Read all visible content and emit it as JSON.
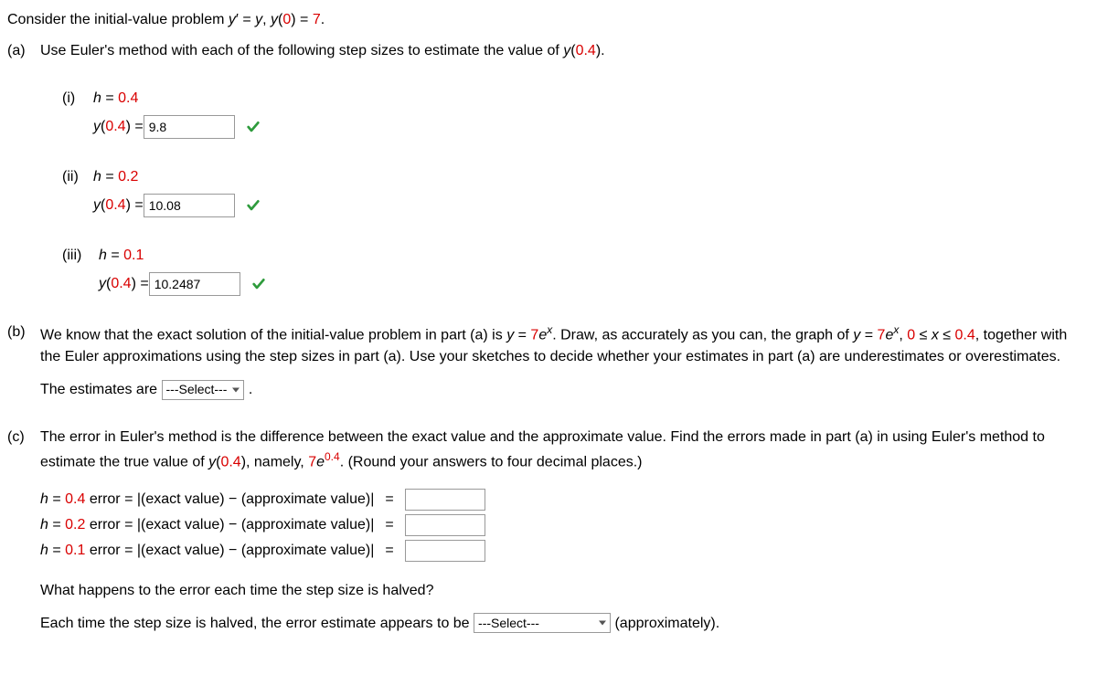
{
  "intro": {
    "prefix": "Consider the initial-value problem ",
    "eq_y": "y",
    "eq_prime": "′",
    "eq_mid1": " = ",
    "eq_rhs": "y",
    "eq_comma": ", ",
    "cond_y": "y",
    "cond_open": "(",
    "cond_val": "0",
    "cond_close": ") = ",
    "cond_rhs": "7",
    "period": "."
  },
  "partA": {
    "label": "(a)",
    "text_pre": "Use Euler's method with each of the following step sizes to estimate the value of ",
    "y": "y",
    "open": "(",
    "arg": "0.4",
    "close": ")",
    "period": ".",
    "items": [
      {
        "label": "(i)",
        "h": "h",
        "eq": " = ",
        "hval": "0.4",
        "y": "y",
        "open": "(",
        "arg": "0.4",
        "close": ") = ",
        "value": "9.8"
      },
      {
        "label": "(ii)",
        "h": "h",
        "eq": " = ",
        "hval": "0.2",
        "y": "y",
        "open": "(",
        "arg": "0.4",
        "close": ") = ",
        "value": "10.08"
      },
      {
        "label": "(iii)",
        "h": "h",
        "eq": " = ",
        "hval": "0.1",
        "y": "y",
        "open": "(",
        "arg": "0.4",
        "close": ") = ",
        "value": "10.2487"
      }
    ]
  },
  "partB": {
    "label": "(b)",
    "t1": "We know that the exact solution of the initial-value problem in part (a) is ",
    "y1": "y",
    "eq1": " = ",
    "coef1": "7",
    "e1": "e",
    "x1": "x",
    "t2": ". Draw, as accurately as you can, the graph of ",
    "y2": "y",
    "eq2": " = ",
    "coef2": "7",
    "e2": "e",
    "x2": "x",
    "t3": ", ",
    "range1": "0",
    "leq1": " ≤ ",
    "xvar": "x",
    "leq2": " ≤ ",
    "range2": "0.4",
    "t4": ", together with the Euler approximations using the step sizes in part (a). Use your sketches to decide whether your estimates in part (a) are underestimates or overestimates.",
    "conclusion_pre": "The estimates are ",
    "select_placeholder": "---Select---",
    "conclusion_post": " ."
  },
  "partC": {
    "label": "(c)",
    "t1": "The error in Euler's method is the difference between the exact value and the approximate value. Find the errors made in part (a) in using Euler's method to estimate the true value of ",
    "y": "y",
    "open": "(",
    "arg": "0.4",
    "close": ")",
    "t2": ", namely, ",
    "coef": "7",
    "e": "e",
    "exp": "0.4",
    "t3": ". (Round your answers to four decimal places.)",
    "errors": [
      {
        "h": "h",
        "eq1": " = ",
        "hval": "0.4",
        "label": " error = |(exact value) − (approximate value)|",
        "eq2": "="
      },
      {
        "h": "h",
        "eq1": " = ",
        "hval": "0.2",
        "label": " error = |(exact value) − (approximate value)|",
        "eq2": "="
      },
      {
        "h": "h",
        "eq1": " = ",
        "hval": "0.1",
        "label": " error = |(exact value) − (approximate value)|",
        "eq2": "="
      }
    ],
    "q": "What happens to the error each time the step size is halved?",
    "final_pre": "Each time the step size is halved, the error estimate appears to be ",
    "select_placeholder": "---Select---",
    "final_post": " (approximately)."
  }
}
